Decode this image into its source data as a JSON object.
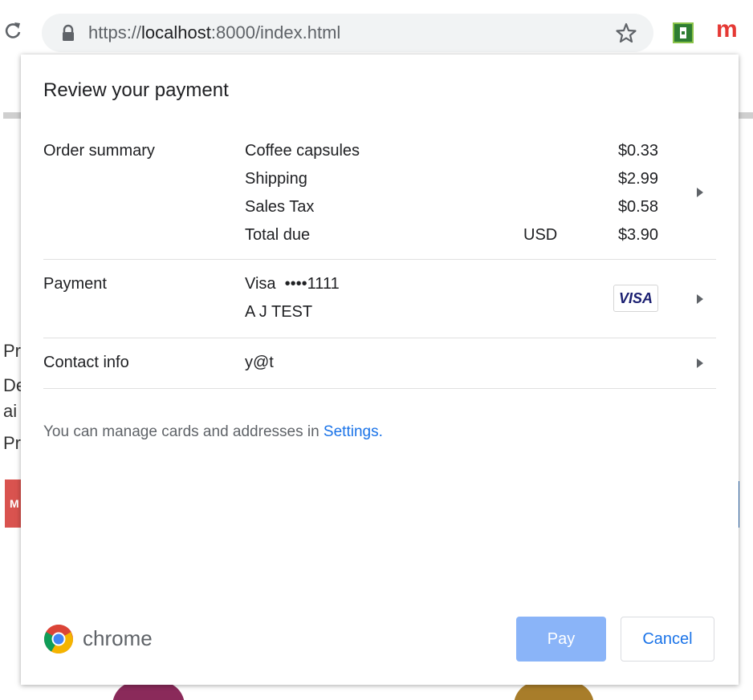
{
  "browser": {
    "url_prefix": "https://",
    "url_host": "localhost",
    "url_rest": ":8000/index.html",
    "ext_2_label": "m"
  },
  "dialog": {
    "title": "Review your payment",
    "order_summary": {
      "label": "Order summary",
      "items": [
        {
          "name": "Coffee capsules",
          "price": "$0.33"
        },
        {
          "name": "Shipping",
          "price": "$2.99"
        },
        {
          "name": "Sales Tax",
          "price": "$0.58"
        }
      ],
      "total": {
        "name": "Total due",
        "currency": "USD",
        "price": "$3.90"
      }
    },
    "payment": {
      "label": "Payment",
      "card": "Visa  ••••1111",
      "holder": "A J TEST",
      "brand_badge": "VISA"
    },
    "contact": {
      "label": "Contact info",
      "value": "y@t"
    },
    "note_text": "You can manage cards and addresses in ",
    "note_link": "Settings.",
    "brand": "chrome",
    "pay_label": "Pay",
    "cancel_label": "Cancel"
  },
  "background": {
    "letters": [
      "Pr",
      "De",
      "ai",
      "Pr"
    ],
    "button_letter": "M"
  },
  "colors": {
    "accent": "#1a73e8",
    "pay_button": "#8ab4f8",
    "visa_blue": "#1a1f71"
  }
}
